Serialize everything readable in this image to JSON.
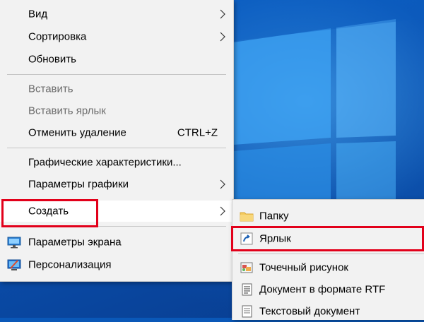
{
  "context_menu": {
    "items": [
      {
        "label": "Вид"
      },
      {
        "label": "Сортировка"
      },
      {
        "label": "Обновить"
      },
      {
        "label": "Вставить"
      },
      {
        "label": "Вставить ярлык"
      },
      {
        "label": "Отменить удаление",
        "shortcut": "CTRL+Z"
      },
      {
        "label": "Графические характеристики..."
      },
      {
        "label": "Параметры графики"
      },
      {
        "label": "Создать"
      },
      {
        "label": "Параметры экрана"
      },
      {
        "label": "Персонализация"
      }
    ]
  },
  "submenu": {
    "items": [
      {
        "label": "Папку",
        "icon": "folder-icon"
      },
      {
        "label": "Ярлык",
        "icon": "shortcut-icon"
      },
      {
        "label": "Точечный рисунок",
        "icon": "bitmap-icon"
      },
      {
        "label": "Документ в формате RTF",
        "icon": "rtf-document-icon"
      },
      {
        "label": "Текстовый документ",
        "icon": "text-document-icon"
      }
    ]
  },
  "colors": {
    "menu_bg": "#f2f2f2",
    "highlight_border": "#e2001a",
    "disabled_text": "#6d6d6d",
    "desktop": "#0a58b8"
  }
}
